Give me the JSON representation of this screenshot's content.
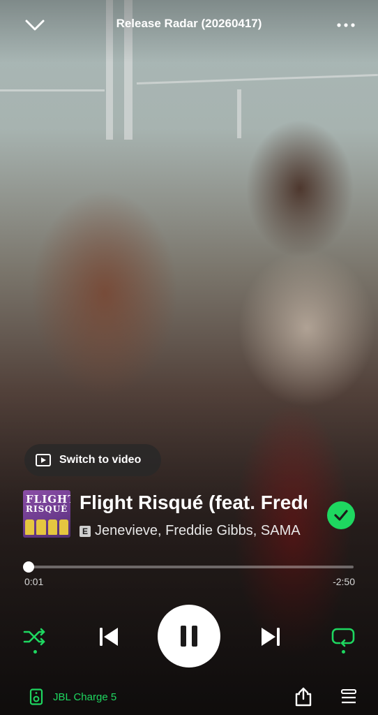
{
  "header": {
    "title": "Release Radar (20260417)"
  },
  "switch_video": {
    "label": "Switch to video"
  },
  "track": {
    "title": "Flight Risqué (feat. Freddie Gibbs, SAMARIA)",
    "explicit_badge": "E",
    "artists": "Jenevieve, Freddie Gibbs, SAMARIA",
    "cover_text_line1": "FLIGHT",
    "cover_text_line2": "RISQUÉ",
    "saved": true
  },
  "progress": {
    "elapsed": "0:01",
    "remaining": "-2:50",
    "fraction": 0.006
  },
  "controls": {
    "shuffle_active": true,
    "repeat_active": true,
    "state": "playing"
  },
  "footer": {
    "device": "JBL Charge 5"
  },
  "colors": {
    "accent": "#1ed760",
    "text": "#ffffff",
    "secondary_text": "#d8d8d8"
  }
}
